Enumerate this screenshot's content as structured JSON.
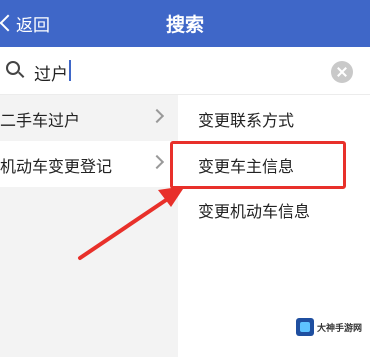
{
  "header": {
    "back_label": "返回",
    "title": "搜索",
    "background": "#3f67c8"
  },
  "search": {
    "value": "过户"
  },
  "left_menu": [
    {
      "label": "二手车过户"
    },
    {
      "label": "机动车变更登记",
      "selected": true
    }
  ],
  "right_menu": [
    {
      "label": "变更联系方式"
    },
    {
      "label": "变更车主信息",
      "highlighted": true
    },
    {
      "label": "变更机动车信息"
    }
  ],
  "annotation": {
    "color": "#e8302a"
  },
  "watermark": {
    "text": "大神手游网"
  }
}
